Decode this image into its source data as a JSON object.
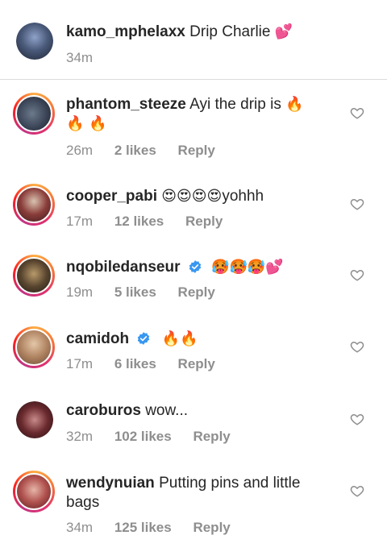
{
  "caption": {
    "username": "kamo_mphelaxx",
    "text": "Drip Charlie",
    "emoji": "💕",
    "time": "34m"
  },
  "comments": [
    {
      "username": "phantom_steeze",
      "text": "Ayi the drip is",
      "emoji_line1": "🔥",
      "emoji_line2": "🔥 🔥",
      "time": "26m",
      "likes": "2 likes",
      "reply": "Reply"
    },
    {
      "username": "cooper_pabi",
      "emoji": "😍😍😍😍",
      "text": "yohhh",
      "time": "17m",
      "likes": "12 likes",
      "reply": "Reply"
    },
    {
      "username": "nqobiledanseur",
      "emoji": "🥵🥵🥵💕",
      "time": "19m",
      "likes": "5 likes",
      "reply": "Reply"
    },
    {
      "username": "camidoh",
      "emoji": "🔥🔥",
      "time": "17m",
      "likes": "6 likes",
      "reply": "Reply"
    },
    {
      "username": "caroburos",
      "text": "wow...",
      "time": "32m",
      "likes": "102 likes",
      "reply": "Reply"
    },
    {
      "username": "wendynuian",
      "text_line1": "Putting pins and little",
      "text_line2": "bags",
      "time": "34m",
      "likes": "125 likes",
      "reply": "Reply"
    }
  ],
  "colors": {
    "text": "#262626",
    "meta": "#8e8e8e",
    "verified": "#3897f0",
    "divider": "#dbdbdb"
  }
}
